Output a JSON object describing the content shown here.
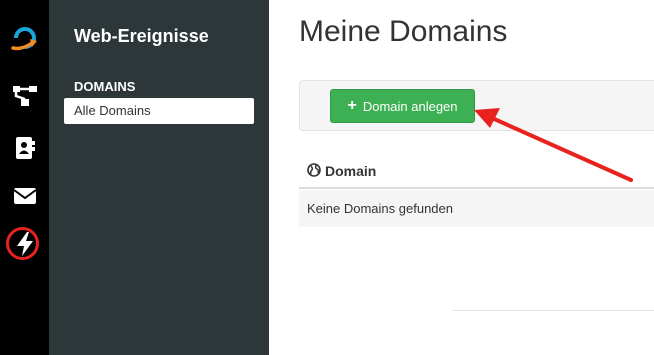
{
  "rail": {
    "icons": [
      {
        "name": "logo-icon"
      },
      {
        "name": "sitemap-icon"
      },
      {
        "name": "contacts-icon"
      },
      {
        "name": "envelope-icon"
      },
      {
        "name": "lightning-icon"
      }
    ],
    "highlight_color": "#e8231f"
  },
  "sidebar": {
    "title": "Web-Ereignisse",
    "section_label": "DOMAINS",
    "items": [
      {
        "label": "Alle Domains"
      }
    ]
  },
  "main": {
    "page_title": "Meine Domains",
    "add_button_label": "Domain anlegen",
    "table": {
      "columns": [
        "Domain"
      ],
      "empty_message": "Keine Domains gefunden"
    }
  },
  "colors": {
    "rail_bg": "#000000",
    "sidebar_bg": "#2d3739",
    "button_green": "#3eb054",
    "annotation_red": "#e8231f",
    "logo_orange": "#f28b22",
    "logo_blue": "#1aa6d9"
  }
}
